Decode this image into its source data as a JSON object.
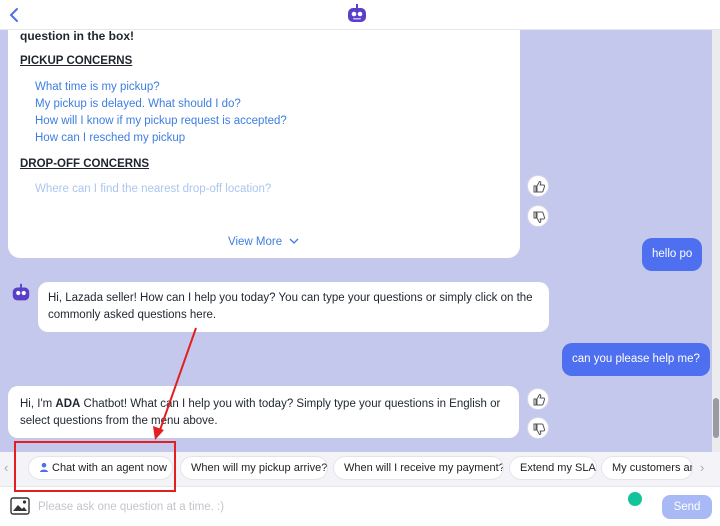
{
  "menu_card": {
    "intro": "question in the box!",
    "pickup_title": "PICKUP CONCERNS",
    "pickup_links": [
      "What time is my pickup?",
      "My pickup is delayed. What should I do?",
      "How will I know if my pickup request is accepted?",
      "How can I resched my pickup"
    ],
    "dropoff_title": "DROP-OFF CONCERNS",
    "dropoff_links": [
      "Where can I find the nearest drop-off location?"
    ],
    "view_more": "View More"
  },
  "messages": {
    "user_1": "hello po",
    "bot_1": "Hi, Lazada seller! How can I help you today? You can type your questions or simply click on the commonly asked questions here.",
    "user_2": "can you please help me?",
    "bot_2_prefix": "Hi, I'm ",
    "bot_2_name": "ADA",
    "bot_2_rest": " Chatbot! What can I help you with today? Simply type your questions in English or select questions from the menu above."
  },
  "suggestions": [
    "Chat with an agent now",
    "When will my pickup arrive?",
    "When will I receive my payment?",
    "Extend my SLA",
    "My customers are"
  ],
  "composer": {
    "placeholder": "Please ask one question at a time. :)",
    "send_label": "Send"
  },
  "colors": {
    "chat_bg": "#c4c8ec",
    "user_bubble": "#4d6ff0",
    "link": "#3d7ee0",
    "send_btn": "#a9b9f6",
    "annotation": "#e2201f"
  },
  "icons": [
    "back-arrow-icon",
    "robot-icon",
    "thumbs-up-icon",
    "thumbs-down-icon",
    "agent-icon",
    "chevron-down-icon",
    "image-icon",
    "grammarly-icon"
  ]
}
